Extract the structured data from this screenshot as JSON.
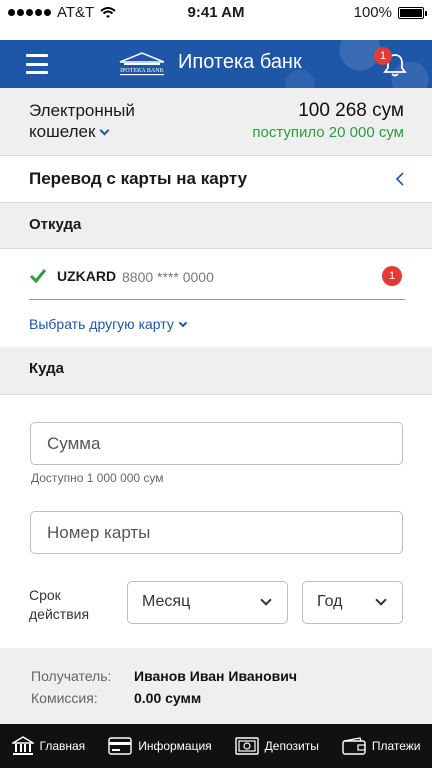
{
  "status_bar": {
    "carrier": "AT&T",
    "time": "9:41 AM",
    "battery": "100%",
    "battery_level": 1.0
  },
  "header": {
    "title": "Ипотека банк",
    "logo_text": "IPOTEKA BANK",
    "notification_count": "1"
  },
  "wallet": {
    "label_line1": "Электронный",
    "label_line2": "кошелек",
    "balance": "100 268 сум",
    "received": "поступило 20 000 сум"
  },
  "transfer": {
    "title": "Перевод с карты на карту"
  },
  "from": {
    "heading": "Откуда",
    "card_brand": "UZKARD",
    "card_number": "8800 **** 0000",
    "badge": "1",
    "choose_other": "Выбрать другую карту"
  },
  "to": {
    "heading": "Куда",
    "amount_placeholder": "Сумма",
    "available": "Доступно 1 000 000 сум",
    "card_placeholder": "Номер карты",
    "expiry_line1": "Срок",
    "expiry_line2": "действия",
    "month": "Месяц",
    "year": "Год"
  },
  "summary": {
    "recipient_label": "Получатель:",
    "recipient_value": "Иванов Иван Иванович",
    "fee_label": "Комиссия:",
    "fee_value": "0.00 сумм"
  },
  "tabbar": {
    "tabs": [
      {
        "label": "Главная",
        "icon": "bank-icon"
      },
      {
        "label": "Информация",
        "icon": "card-icon"
      },
      {
        "label": "Депозиты",
        "icon": "safe-icon"
      },
      {
        "label": "Платежи",
        "icon": "wallet-icon"
      }
    ]
  },
  "colors": {
    "brand": "#1e56a8",
    "accent_green": "#2e9d3c",
    "badge_red": "#e53935",
    "tabbar": "#111111"
  }
}
